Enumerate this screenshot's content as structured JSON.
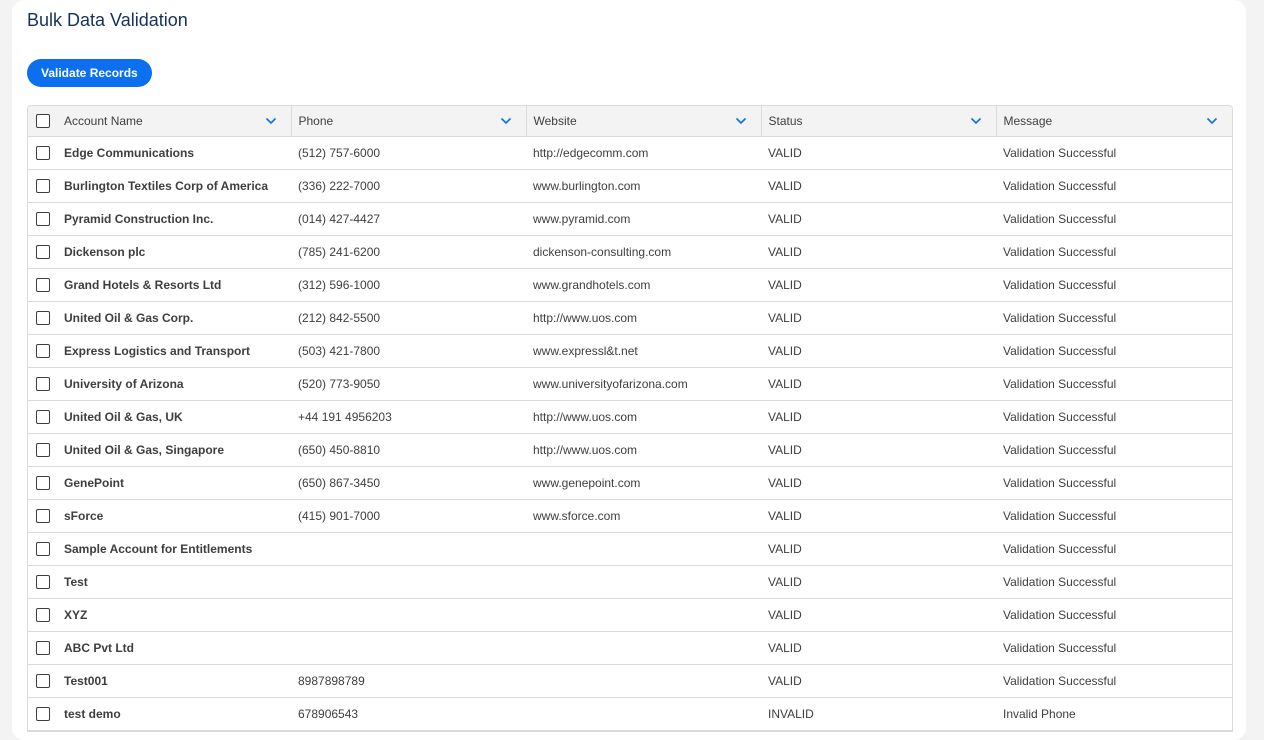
{
  "card": {
    "title": "Bulk Data Validation",
    "validate_button": "Validate Records"
  },
  "colors": {
    "brand": "#0b6ff0",
    "title": "#16325c",
    "header_bg": "#f3f3f3",
    "border": "#dddbda"
  },
  "table": {
    "columns": [
      "Account Name",
      "Phone",
      "Website",
      "Status",
      "Message"
    ],
    "column_icon": "chevron-down-icon",
    "rows": [
      {
        "name": "Edge Communications",
        "phone": "(512) 757-6000",
        "website": "http://edgecomm.com",
        "status": "VALID",
        "message": "Validation Successful"
      },
      {
        "name": "Burlington Textiles Corp of America",
        "phone": "(336) 222-7000",
        "website": "www.burlington.com",
        "status": "VALID",
        "message": "Validation Successful"
      },
      {
        "name": "Pyramid Construction Inc.",
        "phone": "(014) 427-4427",
        "website": "www.pyramid.com",
        "status": "VALID",
        "message": "Validation Successful"
      },
      {
        "name": "Dickenson plc",
        "phone": "(785) 241-6200",
        "website": "dickenson-consulting.com",
        "status": "VALID",
        "message": "Validation Successful"
      },
      {
        "name": "Grand Hotels & Resorts Ltd",
        "phone": "(312) 596-1000",
        "website": "www.grandhotels.com",
        "status": "VALID",
        "message": "Validation Successful"
      },
      {
        "name": "United Oil & Gas Corp.",
        "phone": "(212) 842-5500",
        "website": "http://www.uos.com",
        "status": "VALID",
        "message": "Validation Successful"
      },
      {
        "name": "Express Logistics and Transport",
        "phone": "(503) 421-7800",
        "website": "www.expressl&t.net",
        "status": "VALID",
        "message": "Validation Successful"
      },
      {
        "name": "University of Arizona",
        "phone": "(520) 773-9050",
        "website": "www.universityofarizona.com",
        "status": "VALID",
        "message": "Validation Successful"
      },
      {
        "name": "United Oil & Gas, UK",
        "phone": "+44 191 4956203",
        "website": "http://www.uos.com",
        "status": "VALID",
        "message": "Validation Successful"
      },
      {
        "name": "United Oil & Gas, Singapore",
        "phone": "(650) 450-8810",
        "website": "http://www.uos.com",
        "status": "VALID",
        "message": "Validation Successful"
      },
      {
        "name": "GenePoint",
        "phone": "(650) 867-3450",
        "website": "www.genepoint.com",
        "status": "VALID",
        "message": "Validation Successful"
      },
      {
        "name": "sForce",
        "phone": "(415) 901-7000",
        "website": "www.sforce.com",
        "status": "VALID",
        "message": "Validation Successful"
      },
      {
        "name": "Sample Account for Entitlements",
        "phone": "",
        "website": "",
        "status": "VALID",
        "message": "Validation Successful"
      },
      {
        "name": "Test",
        "phone": "",
        "website": "",
        "status": "VALID",
        "message": "Validation Successful"
      },
      {
        "name": "XYZ",
        "phone": "",
        "website": "",
        "status": "VALID",
        "message": "Validation Successful"
      },
      {
        "name": "ABC Pvt Ltd",
        "phone": "",
        "website": "",
        "status": "VALID",
        "message": "Validation Successful"
      },
      {
        "name": "Test001",
        "phone": "8987898789",
        "website": "",
        "status": "VALID",
        "message": "Validation Successful"
      },
      {
        "name": "test demo",
        "phone": "678906543",
        "website": "",
        "status": "INVALID",
        "message": "Invalid Phone"
      }
    ]
  }
}
